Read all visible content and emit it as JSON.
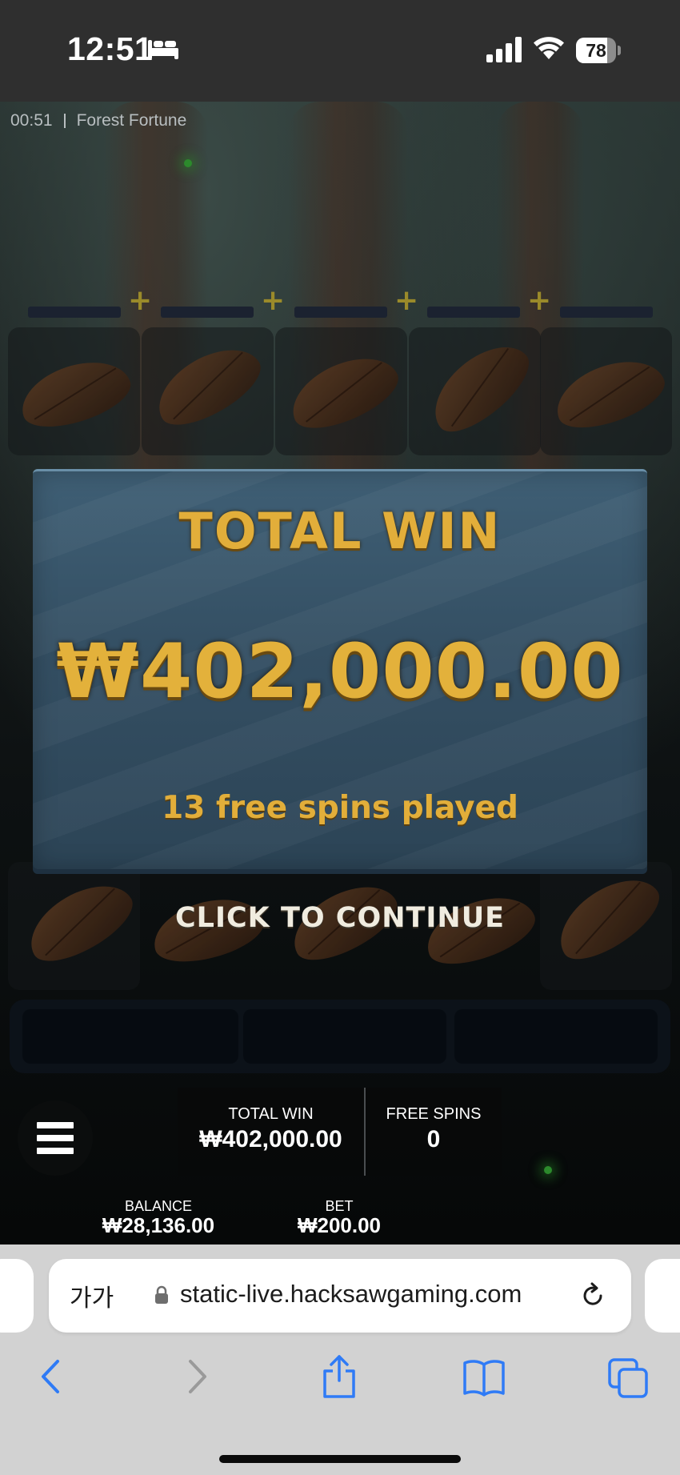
{
  "status_bar": {
    "time": "12:51",
    "battery_level": "78",
    "battery_fraction": 0.78,
    "icons": [
      "bed-icon",
      "cellular-signal-icon",
      "wifi-icon",
      "battery-icon"
    ]
  },
  "game": {
    "timer": "00:51",
    "title": "Forest Fortune",
    "modal": {
      "title": "TOTAL WIN",
      "amount": "₩402,000.00",
      "subtitle": "13 free spins played"
    },
    "continue_label": "CLICK TO CONTINUE",
    "menu_icon": "hamburger-menu-icon",
    "total_win": {
      "label": "TOTAL WIN",
      "value": "₩402,000.00"
    },
    "free_spins": {
      "label": "FREE SPINS",
      "value": "0"
    },
    "balance": {
      "label": "BALANCE",
      "value": "₩28,136.00"
    },
    "bet": {
      "label": "BET",
      "value": "₩200.00"
    },
    "colors": {
      "gold": "#e2ae3a",
      "modal_blue": "#3a5a70"
    }
  },
  "browser": {
    "text_size_label": "가가",
    "url": "static-live.hacksawgaming.com",
    "toolbar_icons": [
      "back-icon",
      "forward-icon",
      "share-icon",
      "bookmarks-icon",
      "tabs-icon"
    ],
    "accent_color": "#2f7bf6"
  }
}
